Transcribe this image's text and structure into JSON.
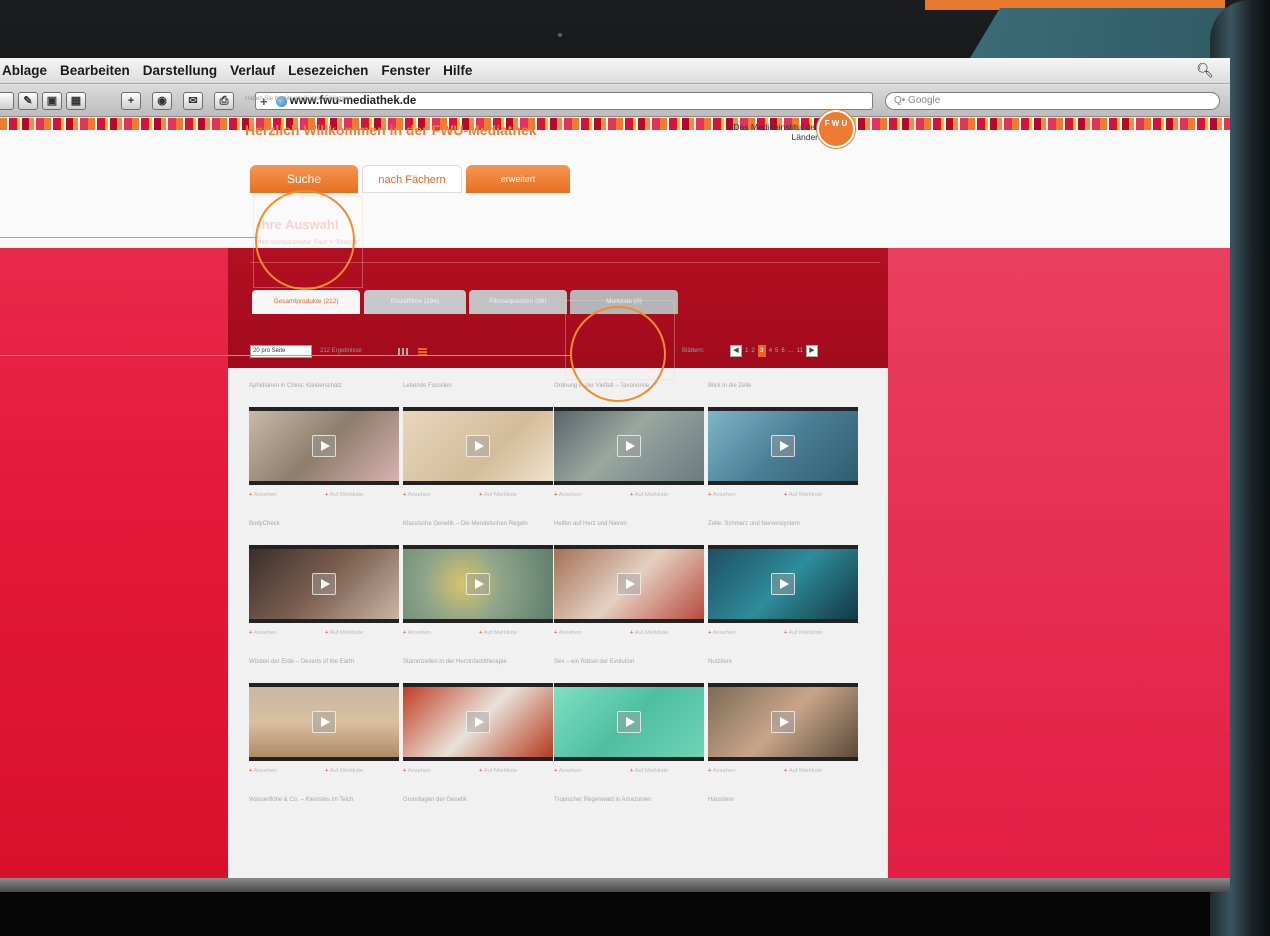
{
  "menubar": {
    "items": [
      "Ablage",
      "Bearbeiten",
      "Darstellung",
      "Verlauf",
      "Lesezeichen",
      "Fenster",
      "Hilfe"
    ],
    "spotlight_icon": "magnifier-icon"
  },
  "toolbar": {
    "url": "www.fwu-mediathek.de",
    "search_placeholder": "Q• Google"
  },
  "page": {
    "login_hint": "Haben Sie bereits ein Konto?   Einloggen",
    "welcome": "Herzlich Willkommen in der FWU-Mediathek",
    "institute": "Das Medieninstitut der Länder",
    "logo_text": "F W U",
    "tabs": [
      "Suche",
      "nach Fächern",
      "erweitert"
    ],
    "selection_title": "Ihre Auswahl",
    "selection_params": "Ihre Suchparameter: Fach > \"Biologie\"",
    "subtabs": [
      "Gesamtprodukte (212)",
      "Einzelfilme (184)",
      "Filmsequenzen (89)",
      "Merkliste (0)"
    ],
    "perpage": "20 pro Seite",
    "hits": "212 Ergebnisse",
    "pages_label": "Blättern:",
    "pager": {
      "prev": "◀",
      "next": "▶",
      "numbers": [
        "1",
        "2",
        "3",
        "4",
        "5",
        "6",
        "…",
        "11"
      ],
      "active_index": 2
    },
    "link_watch": "Ansehen",
    "link_bookmark": "Auf Merkliste",
    "cards": [
      {
        "title": "Aphidianen in China: Kleiderschätz"
      },
      {
        "title": "Lebende Fossilien"
      },
      {
        "title": "Ordnung in der Vielfalt – Taxonomie"
      },
      {
        "title": "Blick in die Zelle"
      },
      {
        "title": "BodyCheck"
      },
      {
        "title": "Klassische Genetik – Die Mendelschen Regeln"
      },
      {
        "title": "Helfen auf Herz und Nieren"
      },
      {
        "title": "Zelle: Schmerz und Nervensystem"
      },
      {
        "title": "Wüsten der Erde – Deserts of the Earth"
      },
      {
        "title": "Stammzellen in der Herzinfarkttherapie"
      },
      {
        "title": "Sex – ein Rätsel der Evolution"
      },
      {
        "title": "Nutztiere"
      },
      {
        "title": "Wasserflöhe & Co. – Kleinstes im Teich"
      },
      {
        "title": "Grundlagen der Genetik"
      },
      {
        "title": "Tropischer Regenwald in Amazonien"
      },
      {
        "title": "Haustiere"
      }
    ]
  },
  "colors": {
    "accent": "#e8662b",
    "red": "#e4183a",
    "annotation": "#f08c2a"
  }
}
